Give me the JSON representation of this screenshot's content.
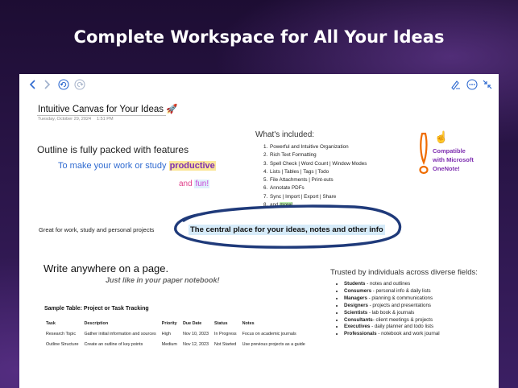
{
  "headline": "Complete Workspace for All Your Ideas",
  "toolbar": {
    "back": "back-arrow-icon",
    "forward": "forward-arrow-icon",
    "undo": "undo-icon",
    "redo": "redo-icon",
    "pen": "pen-icon",
    "more": "more-icon",
    "collapse": "collapse-icon"
  },
  "note": {
    "title": "Intuitive Canvas for Your Ideas 🚀",
    "date": "Tuesday, October 29, 2024",
    "time": "1:51 PM"
  },
  "outline": {
    "heading": "Outline is fully packed with features",
    "sub_prefix": "To make your work or study ",
    "sub_highlight": "productive",
    "fun_prefix": "and ",
    "fun_word": "fun!"
  },
  "included": {
    "heading": "What's included:",
    "items": [
      "Powerful and Intuitive Organization",
      "Rich Text Formatting",
      "Spell Check | Word Count | Window Modes",
      "Lists | Tables | Tags | Todo",
      "File Attachments | Print-outs",
      "Annotate PDFs",
      "Sync | Import | Export | Share"
    ],
    "last_prefix": "and ",
    "last_highlight": "more!"
  },
  "onenote": {
    "hand": "☝",
    "lines": [
      "Compatible",
      "with Microsoft",
      "OneNote!"
    ]
  },
  "great": "Great for work, study and personal projects",
  "central": "The central place for your ideas, notes and other info",
  "write": {
    "heading": "Write anywhere on a page.",
    "sub": "Just like in your paper notebook!"
  },
  "table": {
    "title": "Sample Table: Project or Task Tracking",
    "headers": [
      "Task",
      "Description",
      "Priority",
      "Due Date",
      "Status",
      "Notes"
    ],
    "rows": [
      [
        "Research Topic",
        "Gather initial information and sources",
        "High",
        "Nov 10, 2023",
        "In Progress",
        "Focus on academic journals"
      ],
      [
        "Outline Structure",
        "Create an outline of key points",
        "Medium",
        "Nov 12, 2023",
        "Not Started",
        "Use previous projects as a guide"
      ]
    ]
  },
  "trusted": {
    "heading": "Trusted by individuals across diverse fields:",
    "items": [
      {
        "role": "Students",
        "desc": " - notes and outlines"
      },
      {
        "role": "Consumers",
        "desc": " - personal info & daily lists"
      },
      {
        "role": "Managers",
        "desc": " - planning & communications"
      },
      {
        "role": "Designers",
        "desc": " - projects and presentations"
      },
      {
        "role": "Scientists",
        "desc": " - lab book & journals"
      },
      {
        "role": "Consultants",
        "desc": "- client meetings & projects"
      },
      {
        "role": "Executives",
        "desc": " - daily planner and todo lists"
      },
      {
        "role": "Professionals",
        "desc": " - notebook and work journal"
      }
    ]
  },
  "colors": {
    "accent_blue": "#2f6ad0",
    "highlight_yellow": "#fbe79b",
    "purple": "#7e2fb0",
    "oval_navy": "#1f3a7a"
  }
}
